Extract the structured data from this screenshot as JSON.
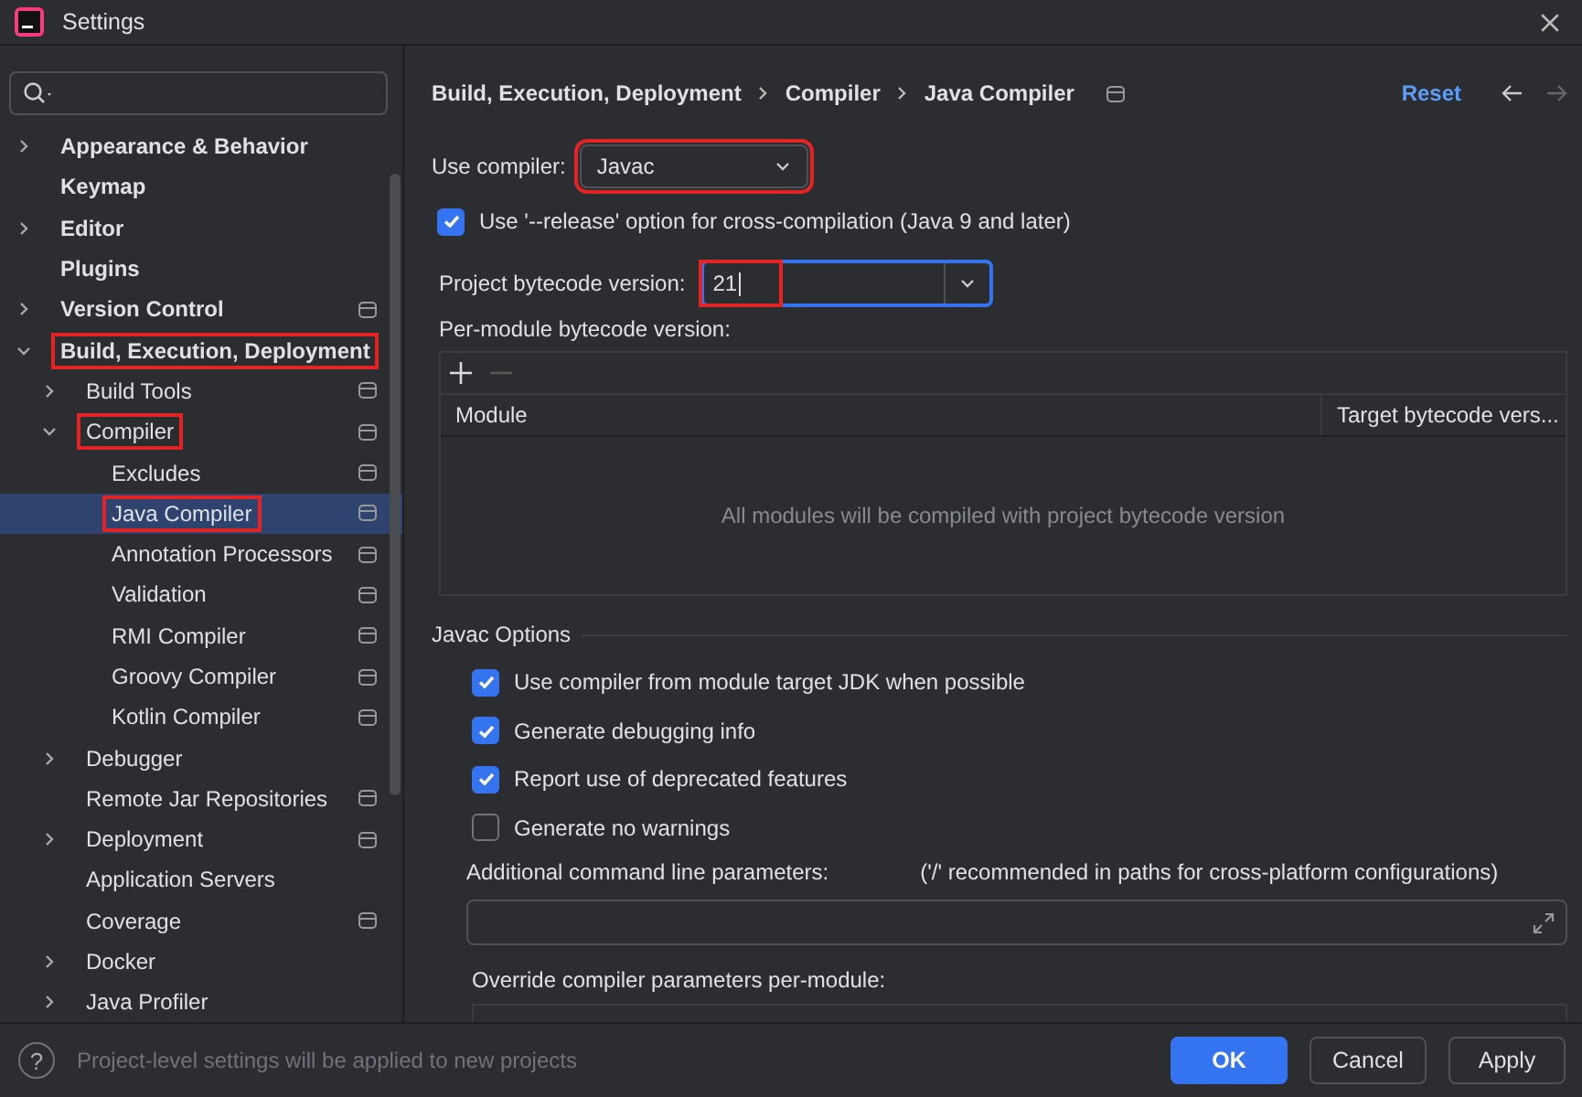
{
  "window": {
    "title": "Settings"
  },
  "sidebar": {
    "items": [
      {
        "label": "Appearance & Behavior",
        "expanded": false,
        "selected": false,
        "highlighted": false,
        "project_level": false
      },
      {
        "label": "Keymap",
        "selected": false,
        "highlighted": false,
        "project_level": false
      },
      {
        "label": "Editor",
        "expanded": false,
        "selected": false,
        "highlighted": false,
        "project_level": false
      },
      {
        "label": "Plugins",
        "selected": false,
        "highlighted": false,
        "project_level": false
      },
      {
        "label": "Version Control",
        "expanded": false,
        "selected": false,
        "highlighted": false,
        "project_level": true
      },
      {
        "label": "Build, Execution, Deployment",
        "expanded": true,
        "selected": false,
        "highlighted": true,
        "project_level": false,
        "children": [
          {
            "label": "Build Tools",
            "expanded": false,
            "selected": false,
            "highlighted": false,
            "project_level": true
          },
          {
            "label": "Compiler",
            "expanded": true,
            "selected": false,
            "highlighted": true,
            "project_level": true,
            "children": [
              {
                "label": "Excludes",
                "selected": false,
                "highlighted": false,
                "project_level": true
              },
              {
                "label": "Java Compiler",
                "selected": true,
                "highlighted": true,
                "project_level": true
              },
              {
                "label": "Annotation Processors",
                "selected": false,
                "highlighted": false,
                "project_level": true
              },
              {
                "label": "Validation",
                "selected": false,
                "highlighted": false,
                "project_level": true
              },
              {
                "label": "RMI Compiler",
                "selected": false,
                "highlighted": false,
                "project_level": true
              },
              {
                "label": "Groovy Compiler",
                "selected": false,
                "highlighted": false,
                "project_level": true
              },
              {
                "label": "Kotlin Compiler",
                "selected": false,
                "highlighted": false,
                "project_level": true
              }
            ]
          },
          {
            "label": "Debugger",
            "expanded": false,
            "selected": false,
            "highlighted": false,
            "project_level": false
          },
          {
            "label": "Remote Jar Repositories",
            "selected": false,
            "highlighted": false,
            "project_level": true
          },
          {
            "label": "Deployment",
            "expanded": false,
            "selected": false,
            "highlighted": false,
            "project_level": true
          },
          {
            "label": "Application Servers",
            "selected": false,
            "highlighted": false,
            "project_level": false
          },
          {
            "label": "Coverage",
            "selected": false,
            "highlighted": false,
            "project_level": true
          },
          {
            "label": "Docker",
            "expanded": false,
            "selected": false,
            "highlighted": false,
            "project_level": false
          },
          {
            "label": "Java Profiler",
            "expanded": false,
            "selected": false,
            "highlighted": false,
            "project_level": false
          }
        ]
      }
    ]
  },
  "breadcrumb": [
    "Build, Execution, Deployment",
    "Compiler",
    "Java Compiler"
  ],
  "reset": "Reset",
  "use_compiler": {
    "label": "Use compiler:",
    "value": "Javac",
    "highlighted": true
  },
  "release_option": {
    "label": "Use '--release' option for cross-compilation (Java 9 and later)",
    "checked": true
  },
  "bytecode": {
    "label": "Project bytecode version:",
    "value": "21",
    "highlighted": true
  },
  "per_module": {
    "label": "Per-module bytecode version:",
    "columns": [
      "Module",
      "Target bytecode vers..."
    ],
    "empty_text": "All modules will be compiled with project bytecode version"
  },
  "javac_options": {
    "title": "Javac Options",
    "options": [
      {
        "label": "Use compiler from module target JDK when possible",
        "checked": true
      },
      {
        "label": "Generate debugging info",
        "checked": true
      },
      {
        "label": "Report use of deprecated features",
        "checked": true
      },
      {
        "label": "Generate no warnings",
        "checked": false
      }
    ],
    "additional_label": "Additional command line parameters:",
    "additional_hint": "('/' recommended in paths for cross-platform configurations)",
    "override_label": "Override compiler parameters per-module:"
  },
  "footer": {
    "help": "?",
    "text": "Project-level settings will be applied to new projects",
    "buttons": [
      {
        "label": "OK",
        "primary": true
      },
      {
        "label": "Cancel",
        "primary": false
      },
      {
        "label": "Apply",
        "primary": false
      }
    ]
  }
}
